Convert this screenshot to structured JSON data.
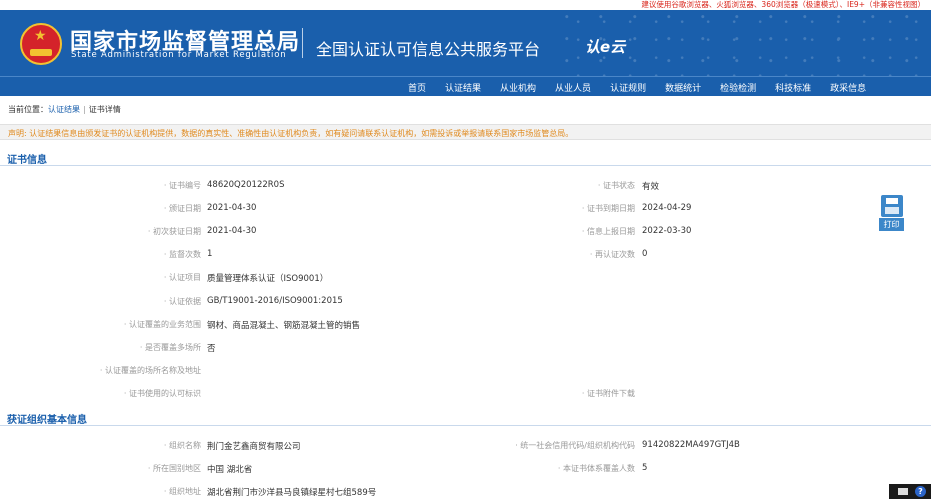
{
  "browser_note": "建议使用谷歌浏览器、火狐浏览器、360浏览器（极速模式）、IE9+（非兼容性视图）",
  "header": {
    "org_cn": "国家市场监督管理总局",
    "org_en": "State Administration for Market Regulation",
    "platform": "全国认证认可信息公共服务平台",
    "platform_logo": "认e云"
  },
  "nav": [
    "首页",
    "认证结果",
    "从业机构",
    "从业人员",
    "认证规则",
    "数据统计",
    "检验检测",
    "科技标准",
    "政采信息"
  ],
  "breadcrumb": {
    "prefix": "当前位置：",
    "link": "认证结果",
    "sep": "|",
    "current": "证书详情"
  },
  "notice": "声明: 认证结果信息由颁发证书的认证机构提供，数据的真实性、准确性由认证机构负责，如有疑问请联系认证机构，如需投诉或举报请联系国家市场监管总局。",
  "cert_section": {
    "title": "证书信息",
    "rows": [
      {
        "l1": "· 证书编号",
        "v1": "48620Q20122R0S",
        "l2": "· 证书状态",
        "v2": "有效"
      },
      {
        "l1": "· 颁证日期",
        "v1": "2021-04-30",
        "l2": "· 证书到期日期",
        "v2": "2024-04-29"
      },
      {
        "l1": "· 初次获证日期",
        "v1": "2021-04-30",
        "l2": "· 信息上报日期",
        "v2": "2022-03-30"
      },
      {
        "l1": "· 监督次数",
        "v1": "1",
        "l2": "· 再认证次数",
        "v2": "0"
      },
      {
        "l1": "· 认证项目",
        "v1": "质量管理体系认证（ISO9001）",
        "l2": "",
        "v2": ""
      },
      {
        "l1": "· 认证依据",
        "v1": "GB/T19001-2016/ISO9001:2015",
        "l2": "",
        "v2": ""
      },
      {
        "l1": "· 认证覆盖的业务范围",
        "v1": "钢材、商品混凝土、钢筋混凝土管的销售",
        "l2": "",
        "v2": ""
      },
      {
        "l1": "· 是否覆盖多场所",
        "v1": "否",
        "l2": "",
        "v2": ""
      },
      {
        "l1": "· 认证覆盖的场所名称及地址",
        "v1": "",
        "l2": "",
        "v2": ""
      },
      {
        "l1": "· 证书使用的认可标识",
        "v1": "",
        "l2": "· 证书附件下载",
        "v2": ""
      }
    ]
  },
  "print_label": "打印",
  "org_section": {
    "title": "获证组织基本信息",
    "rows": [
      {
        "l1": "· 组织名称",
        "v1": "荆门金艺鑫商贸有限公司",
        "l2": "· 统一社会信用代码/组织机构代码",
        "v2": "91420822MA497GTJ4B"
      },
      {
        "l1": "· 所在国别地区",
        "v1": "中国 湖北省",
        "l2": "· 本证书体系覆盖人数",
        "v2": "5"
      },
      {
        "l1": "· 组织地址",
        "v1": "湖北省荆门市沙洋县马良镇绿星村七组589号",
        "l2": "",
        "v2": ""
      }
    ]
  },
  "help_badge": "?"
}
